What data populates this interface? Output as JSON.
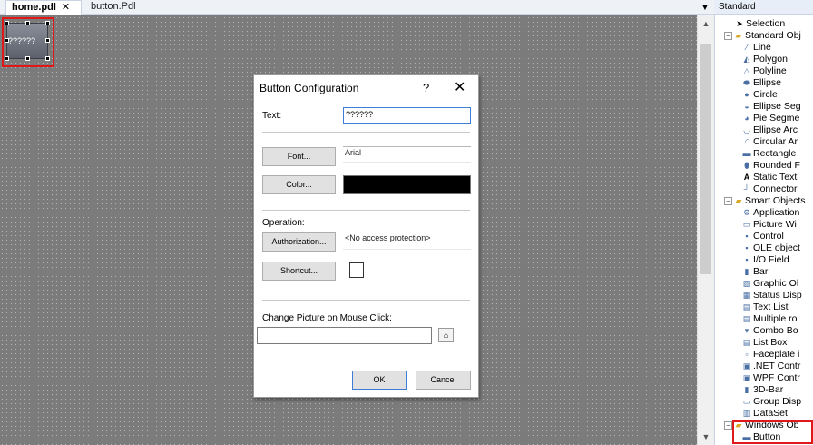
{
  "tabs": [
    {
      "label": "home.pdl",
      "close": "✕"
    },
    {
      "label": "button.Pdl"
    }
  ],
  "tab_dropdown": "▼",
  "canvas": {
    "selected_object_text": "??????"
  },
  "dialog": {
    "title": "Button Configuration",
    "help": "?",
    "close": "✕",
    "text_label": "Text:",
    "text_value": "??????",
    "font_button": "Font...",
    "font_value": "Arial",
    "color_button": "Color...",
    "color_value": "#000000",
    "operation_label": "Operation:",
    "authorization_button": "Authorization...",
    "authorization_value": "<No access protection>",
    "shortcut_button": "Shortcut...",
    "change_picture_label": "Change Picture on Mouse Click:",
    "picture_value": "",
    "ok": "OK",
    "cancel": "Cancel"
  },
  "panel": {
    "title": "Standard",
    "items": [
      {
        "label": "Selection",
        "icon": "arrow-cursor"
      },
      {
        "label": "Standard Obj",
        "icon": "folder"
      },
      {
        "label": "Line",
        "icon": "line"
      },
      {
        "label": "Polygon",
        "icon": "polygon"
      },
      {
        "label": "Polyline",
        "icon": "polyline"
      },
      {
        "label": "Ellipse",
        "icon": "ellipse"
      },
      {
        "label": "Circle",
        "icon": "circle"
      },
      {
        "label": "Ellipse Seg",
        "icon": "ellipse-segment"
      },
      {
        "label": "Pie Segme",
        "icon": "pie-segment"
      },
      {
        "label": "Ellipse Arc",
        "icon": "ellipse-arc"
      },
      {
        "label": "Circular Ar",
        "icon": "circular-arc"
      },
      {
        "label": "Rectangle",
        "icon": "rectangle"
      },
      {
        "label": "Rounded F",
        "icon": "rounded-rectangle"
      },
      {
        "label": "Static Text",
        "icon": "static-text"
      },
      {
        "label": "Connector",
        "icon": "connector"
      },
      {
        "label": "Smart Objects",
        "icon": "folder"
      },
      {
        "label": "Application",
        "icon": "application-window"
      },
      {
        "label": "Picture Wi",
        "icon": "picture-window"
      },
      {
        "label": "Control",
        "icon": "control"
      },
      {
        "label": "OLE object",
        "icon": "ole-object"
      },
      {
        "label": "I/O Field",
        "icon": "io-field"
      },
      {
        "label": "Bar",
        "icon": "bar"
      },
      {
        "label": "Graphic Ol",
        "icon": "graphic-object"
      },
      {
        "label": "Status Disp",
        "icon": "status-display"
      },
      {
        "label": "Text List",
        "icon": "text-list"
      },
      {
        "label": "Multiple ro",
        "icon": "multiple-row"
      },
      {
        "label": "Combo Bo",
        "icon": "combo-box"
      },
      {
        "label": "List Box",
        "icon": "list-box"
      },
      {
        "label": "Faceplate i",
        "icon": "faceplate"
      },
      {
        "label": ".NET Contr",
        "icon": "net-control"
      },
      {
        "label": "WPF Contr",
        "icon": "wpf-control"
      },
      {
        "label": "3D-Bar",
        "icon": "3d-bar"
      },
      {
        "label": "Group Disp",
        "icon": "group-display"
      },
      {
        "label": "DataSet",
        "icon": "dataset"
      },
      {
        "label": "Windows Ob",
        "icon": "folder"
      },
      {
        "label": "Button",
        "icon": "button"
      }
    ]
  }
}
